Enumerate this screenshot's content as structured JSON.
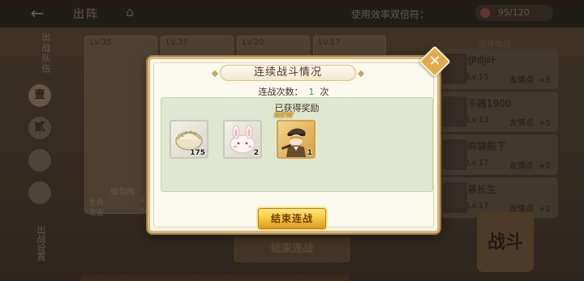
{
  "background": {
    "top_bar": {
      "title": "出阵",
      "stamina_label": "使用效率双倍符：",
      "stamina_value": "95/120"
    },
    "left_rail": {
      "heading": "出战队伍",
      "tabs": [
        "壹",
        "贰",
        "",
        ""
      ],
      "footer": "出战设置"
    },
    "team_cards": [
      {
        "lv": "Lv.35"
      },
      {
        "lv": "Lv.35"
      },
      {
        "lv": "Lv.20"
      },
      {
        "lv": "Lv.17"
      }
    ],
    "character": {
      "name": "饭包肉",
      "stats": [
        {
          "label": "生命",
          "value": "318"
        },
        {
          "label": "攻击",
          "value": "34"
        }
      ]
    },
    "friends_title": "选择助战",
    "friends": [
      {
        "name": "伊向叶",
        "lv": "Lv.15",
        "points_label": "友情点",
        "points": "+5"
      },
      {
        "name": "不器1900",
        "lv": "Lv.13",
        "points_label": "友情点",
        "points": "+5"
      },
      {
        "name": "麻袋殿下",
        "lv": "Lv.17",
        "points_label": "友情点",
        "points": "+2"
      },
      {
        "name": "慕长生",
        "lv": "Lv.17",
        "points_label": "友情点",
        "points": "+2"
      }
    ],
    "battle_button": "战斗",
    "end_button": "结束连战"
  },
  "modal": {
    "title": "连续战斗情况",
    "count_label": "连战次数：",
    "count_value": "1",
    "count_unit": "次",
    "reward_heading": "已获得奖励",
    "rewards": [
      {
        "icon": "dumpling-icon",
        "qty": "175"
      },
      {
        "icon": "rabbit-bun-icon",
        "qty": "2"
      },
      {
        "icon": "character-card-icon",
        "qty": "1",
        "badge": "NEW"
      }
    ],
    "end_button": "结束连战",
    "close_icon": "close-icon"
  },
  "colors": {
    "accent_gold": "#f4c33a",
    "count_green": "#3e9c4a",
    "panel_green": "#dfe7cf"
  }
}
